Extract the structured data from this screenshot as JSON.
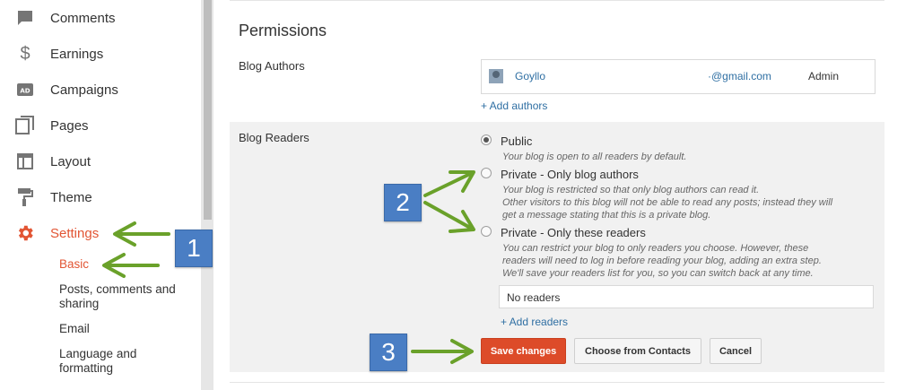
{
  "sidebar": {
    "items": [
      {
        "label": "Comments",
        "icon": "comment-icon"
      },
      {
        "label": "Earnings",
        "icon": "dollar-icon"
      },
      {
        "label": "Campaigns",
        "icon": "ad-icon"
      },
      {
        "label": "Pages",
        "icon": "pages-icon"
      },
      {
        "label": "Layout",
        "icon": "layout-icon"
      },
      {
        "label": "Theme",
        "icon": "paint-roller-icon"
      },
      {
        "label": "Settings",
        "icon": "gear-icon",
        "active": true
      }
    ],
    "sub_items": [
      {
        "label": "Basic",
        "active": true
      },
      {
        "label": "Posts, comments and sharing"
      },
      {
        "label": "Email"
      },
      {
        "label": "Language and formatting"
      }
    ]
  },
  "permissions": {
    "title": "Permissions",
    "blog_authors_label": "Blog Authors",
    "author": {
      "name": "Goyllo",
      "email": "·@gmail.com",
      "role": "Admin"
    },
    "add_authors": "+ Add authors",
    "blog_readers_label": "Blog Readers",
    "options": [
      {
        "title": "Public",
        "desc": [
          "Your blog is open to all readers by default."
        ],
        "checked": true
      },
      {
        "title": "Private - Only blog authors",
        "desc": [
          "Your blog is restricted so that only blog authors can read it.",
          "Other visitors to this blog will not be able to read any posts; instead they will",
          "get a message stating that this is a private blog."
        ],
        "checked": false
      },
      {
        "title": "Private - Only these readers",
        "desc": [
          "You can restrict your blog to only readers you choose. However, these",
          "readers will need to log in before reading your blog, adding an extra step.",
          "We'll save your readers list for you, so you can switch back at any time."
        ],
        "checked": false
      }
    ],
    "readers_input_value": "No readers",
    "add_readers": "+ Add readers",
    "buttons": {
      "save": "Save changes",
      "choose_contacts": "Choose from Contacts",
      "cancel": "Cancel"
    }
  },
  "annotations": {
    "badge_1": "1",
    "badge_2": "2",
    "badge_3": "3"
  },
  "colors": {
    "accent": "#e25534",
    "link": "#2f6fa3",
    "badge": "#4a7ec4",
    "arrow": "#6aa12a"
  }
}
